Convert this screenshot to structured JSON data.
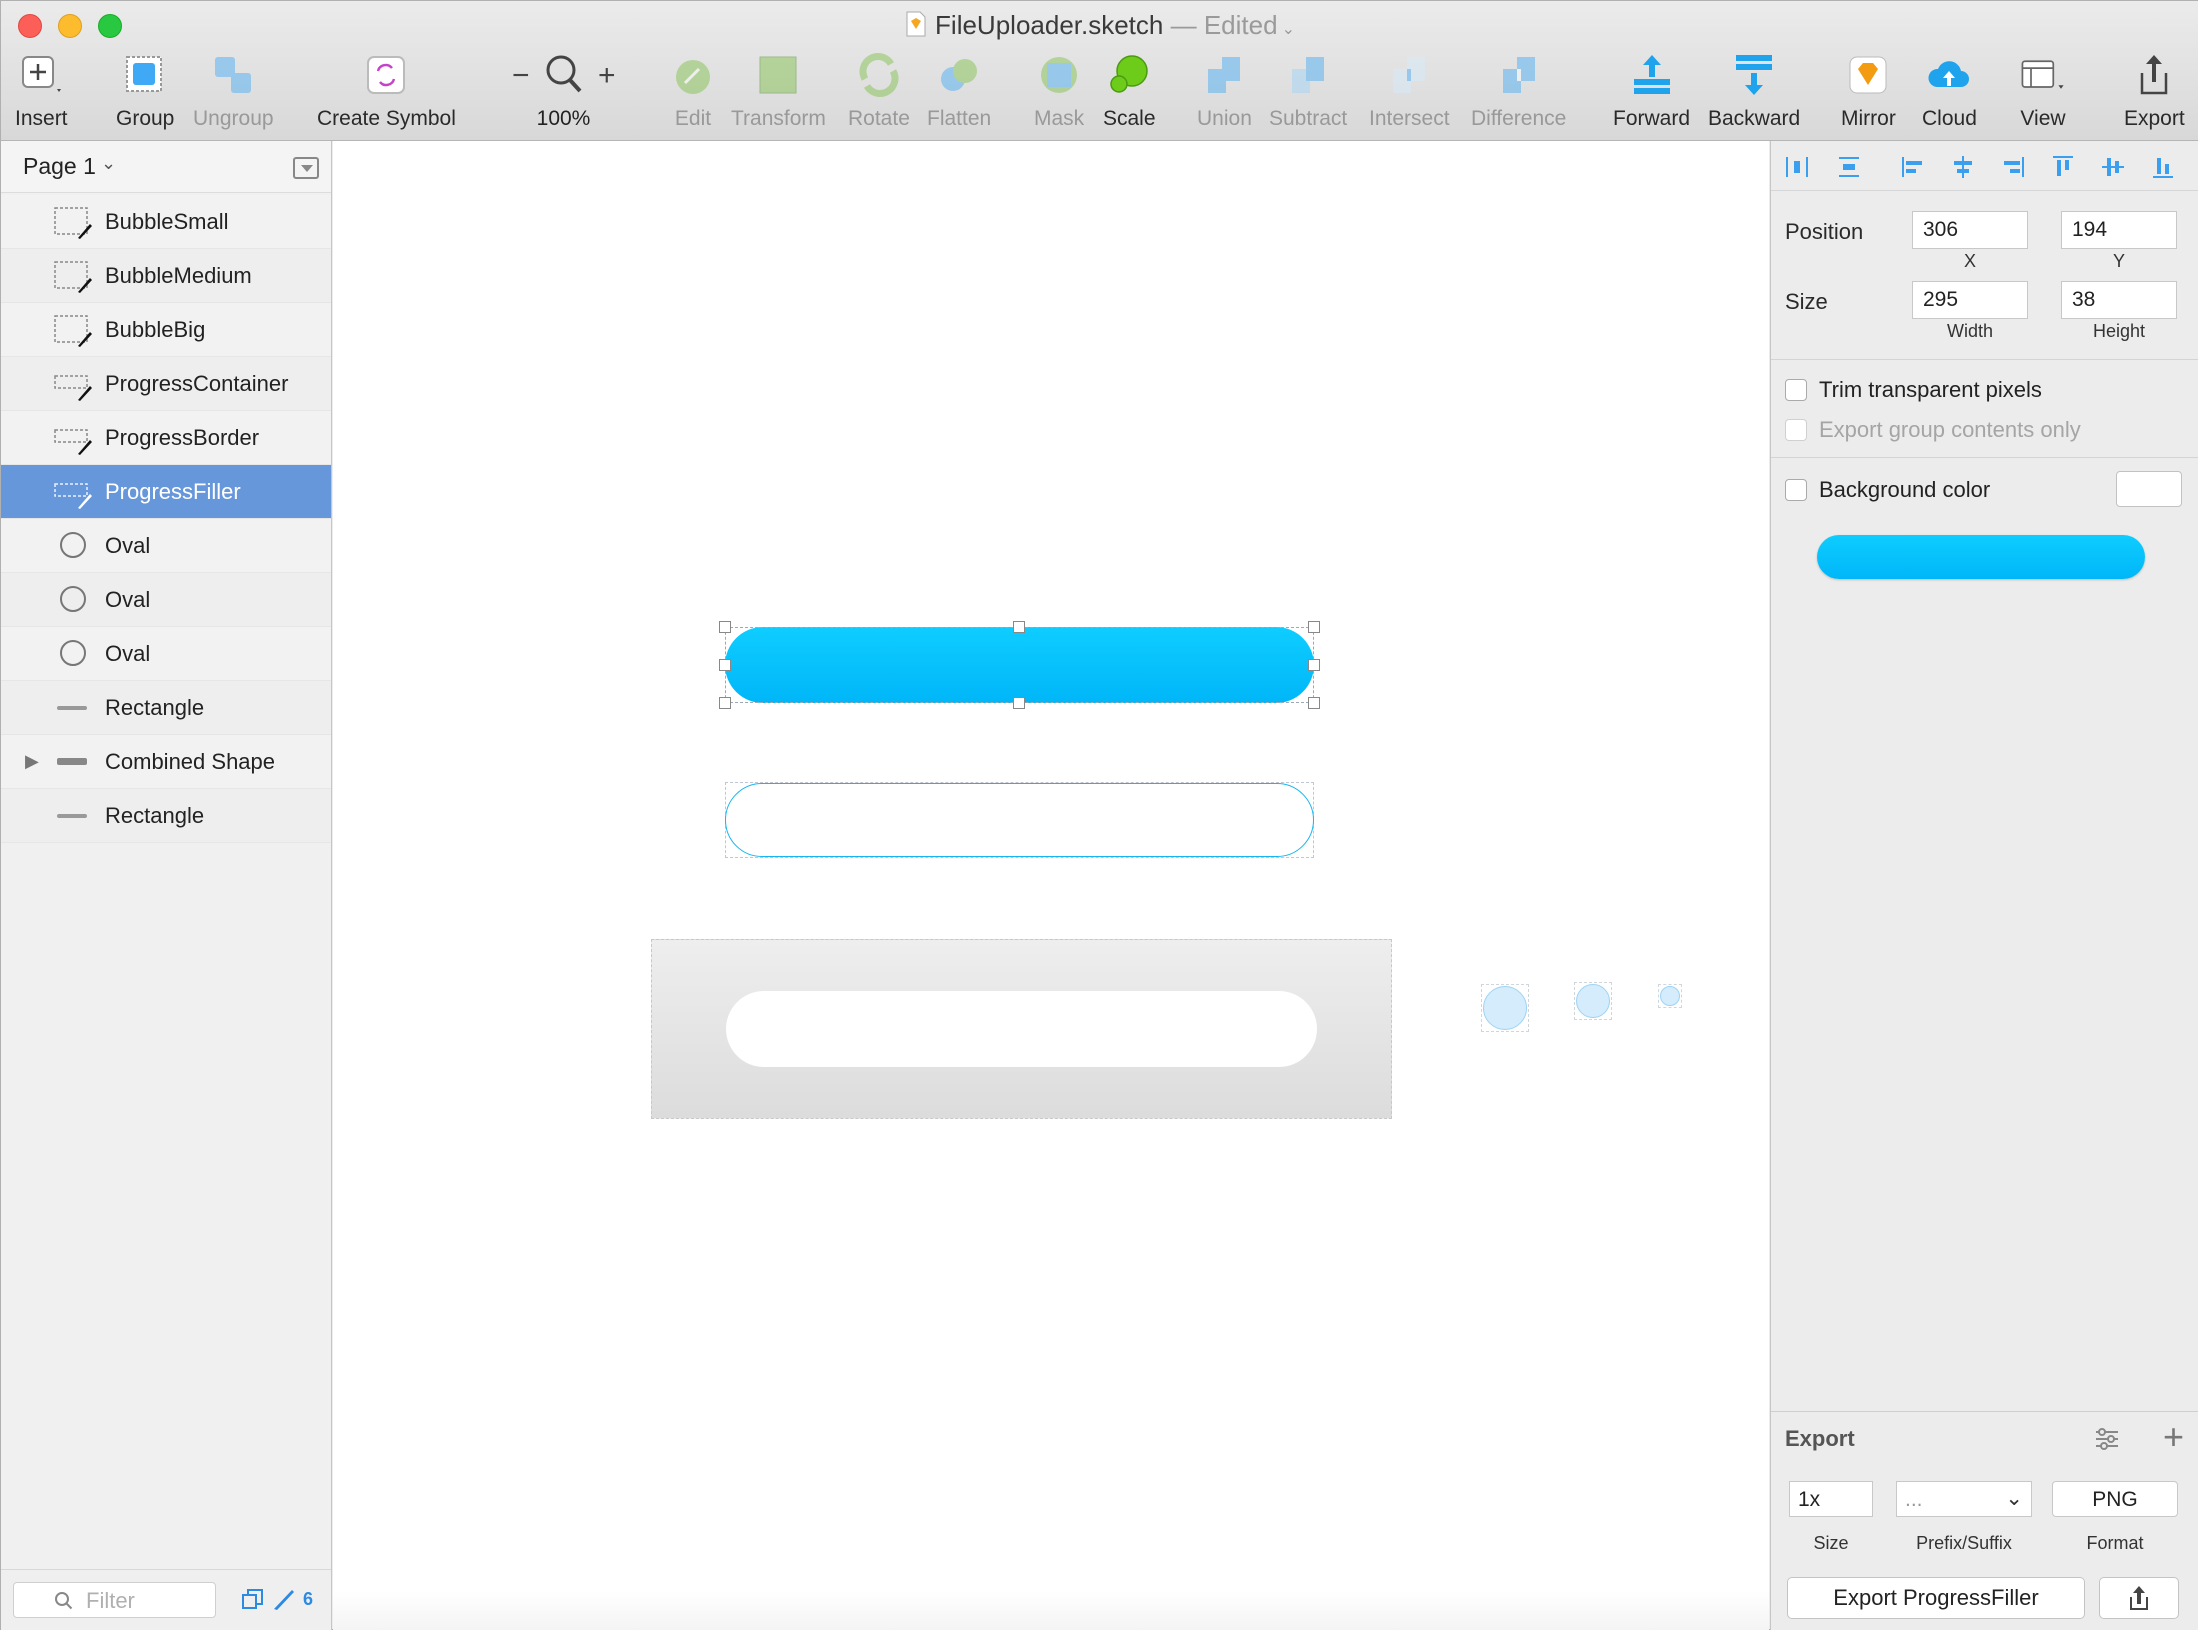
{
  "window": {
    "file_name": "FileUploader.sketch",
    "edited_suffix": "— Edited"
  },
  "toolbar": {
    "insert": "Insert",
    "group": "Group",
    "ungroup": "Ungroup",
    "create_symbol": "Create Symbol",
    "zoom": "100%",
    "edit": "Edit",
    "transform": "Transform",
    "rotate": "Rotate",
    "flatten": "Flatten",
    "mask": "Mask",
    "scale": "Scale",
    "union": "Union",
    "subtract": "Subtract",
    "intersect": "Intersect",
    "difference": "Difference",
    "forward": "Forward",
    "backward": "Backward",
    "mirror": "Mirror",
    "cloud": "Cloud",
    "view": "View",
    "export": "Export"
  },
  "sidebar": {
    "page": "Page 1",
    "layers": [
      {
        "label": "BubbleSmall",
        "icon": "slice-icon"
      },
      {
        "label": "BubbleMedium",
        "icon": "slice-icon"
      },
      {
        "label": "BubbleBig",
        "icon": "slice-icon"
      },
      {
        "label": "ProgressContainer",
        "icon": "slice-icon"
      },
      {
        "label": "ProgressBorder",
        "icon": "slice-icon"
      },
      {
        "label": "ProgressFiller",
        "icon": "slice-icon",
        "selected": true
      },
      {
        "label": "Oval",
        "icon": "oval-icon"
      },
      {
        "label": "Oval",
        "icon": "oval-icon"
      },
      {
        "label": "Oval",
        "icon": "oval-icon"
      },
      {
        "label": "Rectangle",
        "icon": "rectangle-icon"
      },
      {
        "label": "Combined Shape",
        "icon": "combined-shape-icon"
      },
      {
        "label": "Rectangle",
        "icon": "rectangle-icon"
      }
    ],
    "filter_placeholder": "Filter",
    "filter_count": "6"
  },
  "inspector": {
    "position_label": "Position",
    "x": "306",
    "y": "194",
    "x_label": "X",
    "y_label": "Y",
    "size_label": "Size",
    "width": "295",
    "height": "38",
    "width_label": "Width",
    "height_label": "Height",
    "trim_label": "Trim transparent pixels",
    "export_group_label": "Export group contents only",
    "bg_color_label": "Background color",
    "export_title": "Export",
    "export_size": "1x",
    "export_prefix": "...",
    "export_format": "PNG",
    "size_caption": "Size",
    "prefix_caption": "Prefix/Suffix",
    "format_caption": "Format",
    "export_button": "Export ProgressFiller"
  },
  "colors": {
    "accent_blue": "#00b6f8",
    "selection": "#6797db"
  }
}
